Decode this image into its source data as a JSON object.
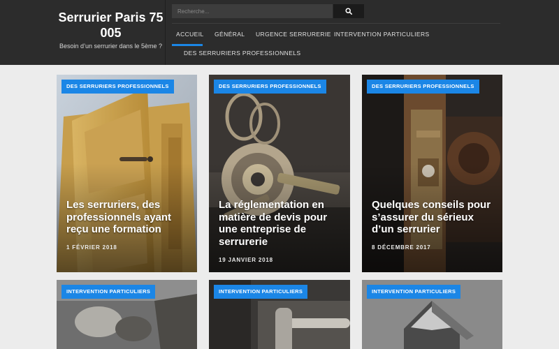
{
  "site": {
    "title": "Serrurier Paris 75 005",
    "tagline": "Besoin d’un serrurier dans le 5ème ?"
  },
  "search": {
    "placeholder": "Recherche...",
    "icon": "search-icon"
  },
  "nav": {
    "items": [
      "ACCUEIL",
      "GÉNÉRAL",
      "URGENCE SERRURERIE",
      "INTERVENTION PARTICULIERS",
      "DES SERRURIERS PROFESSIONNELS"
    ],
    "active": "ACCUEIL"
  },
  "posts": [
    {
      "category": "DES SERRURIERS PROFESSIONNELS",
      "title": "Les serruriers, des professionnels ayant reçu une formation",
      "date": "1 FÉVRIER 2018"
    },
    {
      "category": "DES SERRURIERS PROFESSIONNELS",
      "title": "La réglementation en matière de devis pour une entreprise de serrurerie",
      "date": "19 JANVIER 2018"
    },
    {
      "category": "DES SERRURIERS PROFESSIONNELS",
      "title": "Quelques conseils pour s’assurer du sérieux d’un serrurier",
      "date": "8 DÉCEMBRE 2017"
    },
    {
      "category": "INTERVENTION PARTICULIERS"
    },
    {
      "category": "INTERVENTION PARTICULIERS"
    },
    {
      "category": "INTERVENTION PARTICULIERS"
    }
  ],
  "colors": {
    "header": "#2c2c2c",
    "accent": "#1b86e6",
    "page": "#ececec"
  }
}
